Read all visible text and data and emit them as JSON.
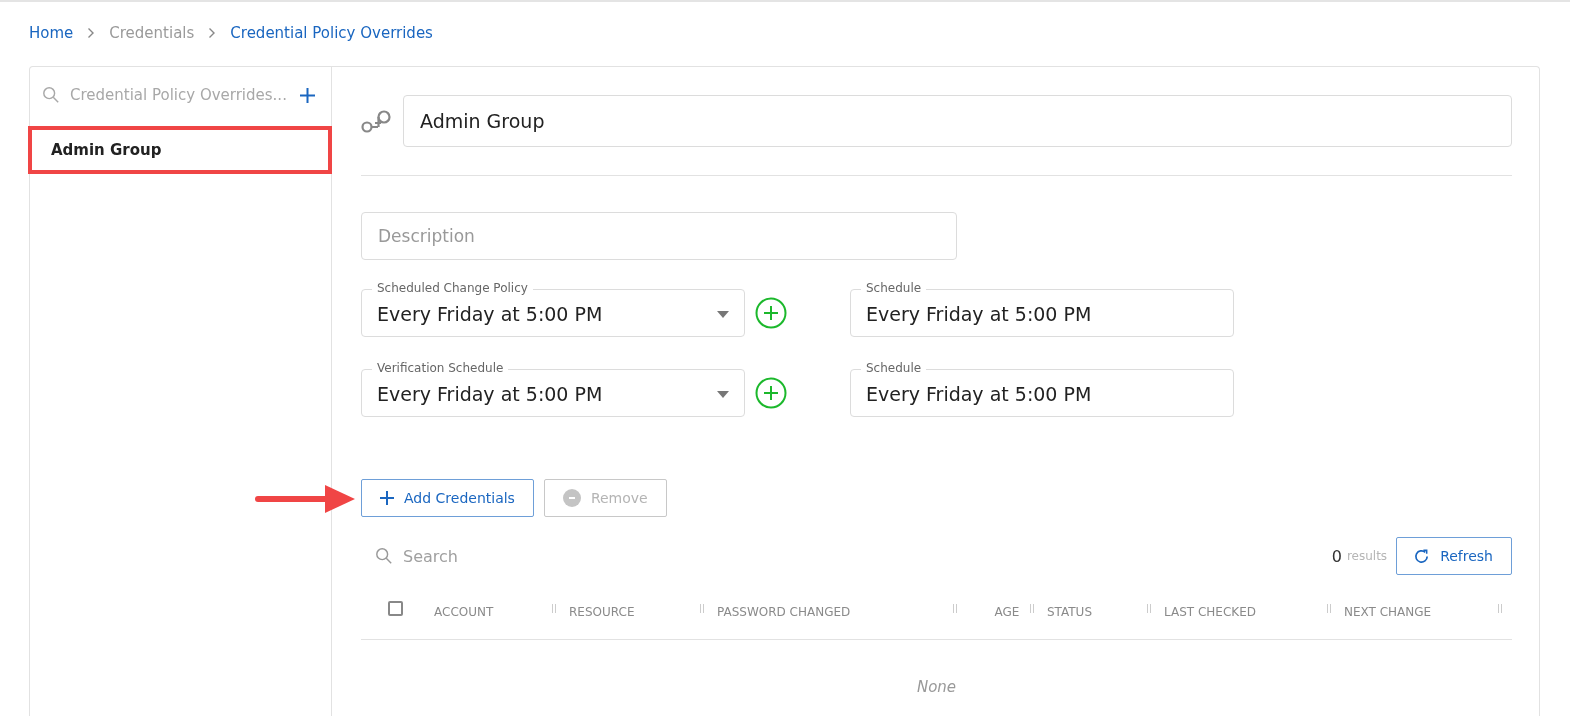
{
  "breadcrumb": [
    {
      "label": "Home",
      "link": true
    },
    {
      "label": "Credentials",
      "link": false
    },
    {
      "label": "Credential Policy Overrides",
      "link": true
    }
  ],
  "sidebar": {
    "search": {
      "placeholder": "Credential Policy Overrides..."
    },
    "items": [
      {
        "label": "Admin Group",
        "highlighted": true
      }
    ]
  },
  "editor": {
    "name": {
      "value": "Admin Group"
    },
    "description": {
      "placeholder": "Description"
    },
    "policies": [
      {
        "label": "Scheduled Change Policy",
        "value": "Every Friday at 5:00 PM",
        "schedule_label": "Schedule",
        "schedule_value": "Every Friday at 5:00 PM"
      },
      {
        "label": "Verification Schedule",
        "value": "Every Friday at 5:00 PM",
        "schedule_label": "Schedule",
        "schedule_value": "Every Friday at 5:00 PM"
      }
    ],
    "buttons": [
      {
        "label": "Add Credentials",
        "kind": "add",
        "disabled": false
      },
      {
        "label": "Remove",
        "kind": "remove",
        "disabled": true
      }
    ]
  },
  "table": {
    "search": {
      "placeholder": "Search"
    },
    "count": "0",
    "count_label": "results",
    "refresh": "Refresh",
    "select_all": {
      "checked": false
    },
    "columns": [
      "ACCOUNT",
      "RESOURCE",
      "PASSWORD CHANGED",
      "AGE",
      "STATUS",
      "LAST CHECKED",
      "NEXT CHANGE"
    ],
    "empty": "None"
  }
}
